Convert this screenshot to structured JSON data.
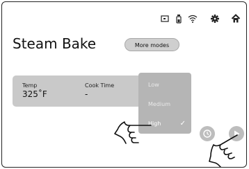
{
  "screen": {
    "title": "Steam Bake",
    "more_modes_label": "More modes"
  },
  "status_icons": [
    "screen-icon",
    "timer-icon",
    "wifi-icon",
    "settings-icon",
    "home-icon"
  ],
  "settings": {
    "temp_label": "Temp",
    "temp_value": "325˚F",
    "cook_time_label": "Cook Time",
    "cook_time_value": "-"
  },
  "steam_dropdown": {
    "options": [
      "Low",
      "Medium",
      "High"
    ],
    "selected": "High",
    "check_icon": "check-icon"
  },
  "round_buttons": [
    "clock-icon",
    "play-icon"
  ],
  "colors": {
    "card": "#c9c9c9",
    "dropdown": "#b5b5b5",
    "button": "#cfcfcf"
  }
}
